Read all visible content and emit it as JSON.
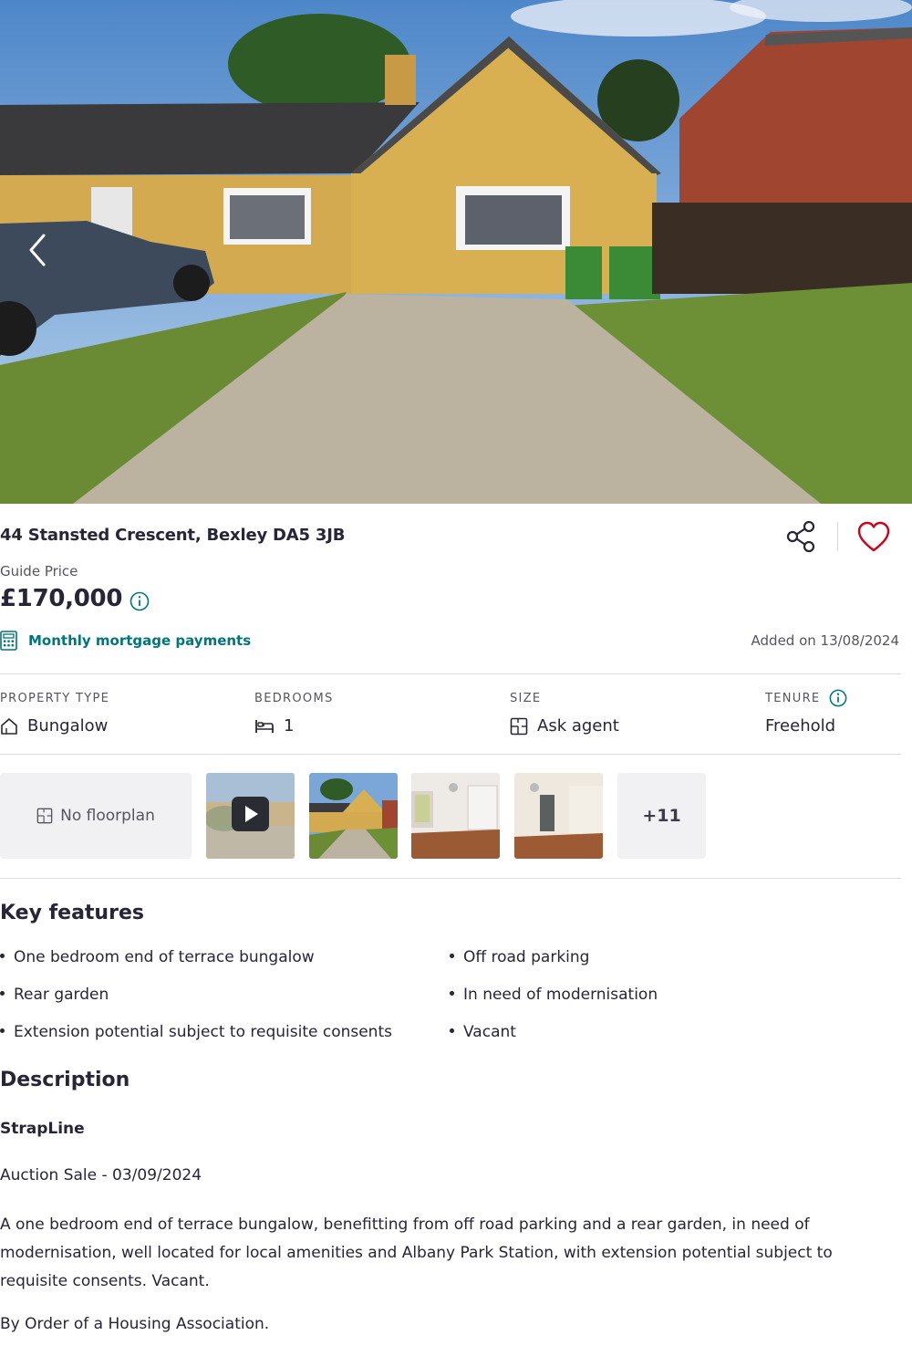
{
  "gallery": {
    "prev_icon": "chevron-left-icon",
    "more_label": "+11"
  },
  "listing": {
    "address": "44 Stansted Crescent, Bexley DA5 3JB",
    "price_qualifier": "Guide Price",
    "price": "£170,000",
    "mortgage_label": "Monthly mortgage payments",
    "added": "Added on 13/08/2024"
  },
  "actions": {
    "share_icon": "share-icon",
    "favourite_icon": "heart-icon"
  },
  "stats": [
    {
      "label": "PROPERTY TYPE",
      "value": "Bungalow",
      "icon": "house-icon"
    },
    {
      "label": "BEDROOMS",
      "value": "1",
      "icon": "bed-icon"
    },
    {
      "label": "SIZE",
      "value": "Ask agent",
      "icon": "floorplan-icon"
    },
    {
      "label": "TENURE",
      "value": "Freehold",
      "icon": "info-icon"
    }
  ],
  "media": {
    "floorplan_label": "No floorplan"
  },
  "key_features": {
    "title": "Key features",
    "items": [
      "One bedroom end of terrace bungalow",
      "Off road parking",
      "Rear garden",
      "In need of modernisation",
      "Extension potential subject to requisite consents",
      "Vacant"
    ]
  },
  "description": {
    "title": "Description",
    "subtitle": "StrapLine",
    "auction": "Auction Sale - 03/09/2024",
    "body": "A one bedroom end of terrace bungalow, benefitting from off road parking and a rear garden, in need of modernisation, well located for local amenities and Albany Park Station, with extension potential subject to requisite consents. Vacant.",
    "order": "By Order of a Housing Association."
  },
  "colors": {
    "accent": "#00757a",
    "text": "#262637",
    "favourite": "#d0021b"
  }
}
